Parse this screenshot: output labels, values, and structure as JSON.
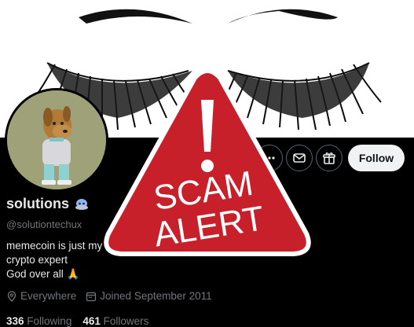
{
  "profile": {
    "name": "solutions",
    "handle": "@solutiontechux",
    "bio_lines": [
      "memecoin is just my t",
      "crypto expert",
      "God over all 🙏"
    ],
    "location": "Everywhere",
    "joined": "Joined September 2011",
    "following_count": "336",
    "following_label": "Following",
    "followers_count": "461",
    "followers_label": "Followers"
  },
  "actions": {
    "follow_label": "Follow",
    "icons": [
      "more-icon",
      "message-icon",
      "gift-icon"
    ]
  },
  "overlay": {
    "line1": "SCAM",
    "line2": "ALERT",
    "color": "#c8202a"
  }
}
